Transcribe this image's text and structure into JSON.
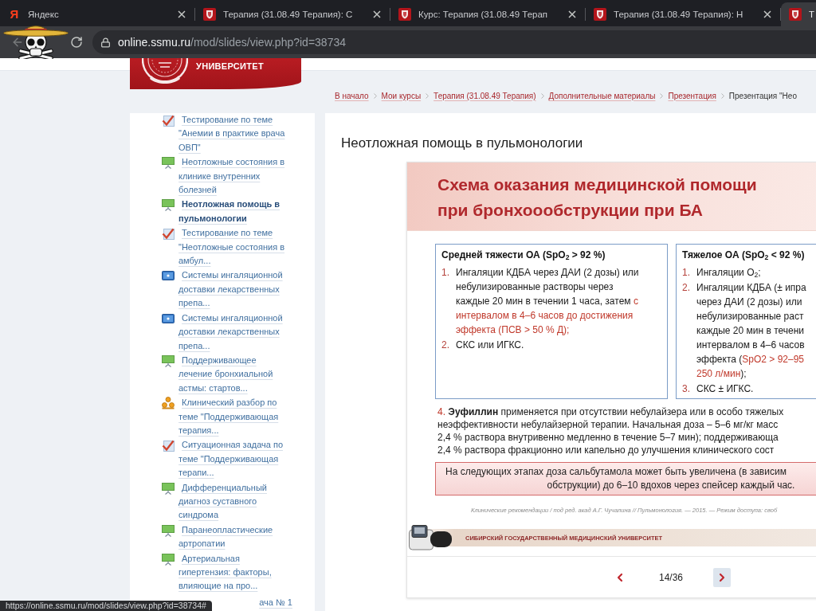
{
  "browser": {
    "tabs": [
      {
        "kind": "letter",
        "glyph": "Я",
        "title": "Яндекс",
        "closable": true,
        "selected": false
      },
      {
        "kind": "crest",
        "title": "Терапия (31.08.49 Терапия): С",
        "closable": true,
        "selected": false
      },
      {
        "kind": "crest",
        "title": "Курс: Терапия (31.08.49 Терап",
        "closable": true,
        "selected": false
      },
      {
        "kind": "crest",
        "title": "Терапия (31.08.49 Терапия): Н",
        "closable": true,
        "selected": false
      },
      {
        "kind": "crest",
        "title": "Т",
        "closable": false,
        "selected": true
      }
    ],
    "address_bar": {
      "host": "online.ssmu.ru",
      "path": "/mod/slides/view.php?id=38734"
    },
    "status_url": "https://online.ssmu.ru/mod/slides/view.php?id=38734#"
  },
  "header": {
    "logo_text": "УНИВЕРСИТЕТ"
  },
  "breadcrumb": [
    {
      "label": "В начало",
      "current": false
    },
    {
      "label": "Мои курсы",
      "current": false
    },
    {
      "label": "Терапия (31.08.49 Терапия)",
      "current": false
    },
    {
      "label": "Дополнительные материалы",
      "current": false
    },
    {
      "label": "Презентация",
      "current": false
    },
    {
      "label": "Презентация \"Нео",
      "current": true
    }
  ],
  "sidebar": {
    "items": [
      {
        "kind": "quiz",
        "label": "Тестирование по теме \"Анемии в практике врача ОВП\"",
        "selected": false
      },
      {
        "kind": "slides",
        "label": "Неотложные состояния в клинике внутренних болезней",
        "selected": false
      },
      {
        "kind": "slides",
        "label": "Неотложная помощь в пульмонологии",
        "selected": true
      },
      {
        "kind": "quiz",
        "label": "Тестирование по теме \"Неотложные состояния в амбул...",
        "selected": false
      },
      {
        "kind": "video",
        "label": "Системы ингаляционной доставки лекарственных препа...",
        "selected": false
      },
      {
        "kind": "video",
        "label": "Системы ингаляционной доставки лекарственных препа...",
        "selected": false
      },
      {
        "kind": "slides",
        "label": "Поддерживающее лечение бронхиальной астмы: стартов...",
        "selected": false
      },
      {
        "kind": "workshop",
        "label": "Клинический разбор по теме \"Поддерживающая терапия...",
        "selected": false
      },
      {
        "kind": "quiz",
        "label": "Ситуационная задача по теме \"Поддерживающая терапи...",
        "selected": false
      },
      {
        "kind": "slides",
        "label": "Дифференциальный диагноз суставного синдрома",
        "selected": false
      },
      {
        "kind": "slides",
        "label": "Паранеопластические артропатии",
        "selected": false
      },
      {
        "kind": "slides",
        "label": "Артериальная гипертензия: факторы, влияющие на про...",
        "selected": false
      }
    ],
    "cut_item": "ача № 1"
  },
  "content": {
    "title": "Неотложная помощь в пульмонологии",
    "slide": {
      "title_lines": [
        "Схема оказания медицинской помощи",
        "при бронхоообструкции при БА"
      ],
      "boxes": [
        {
          "heading": "Средней тяжести ОА (SpO$_{2}$ > 92 %)",
          "items": [
            {
              "number": "1.",
              "lines": [
                [
                  {
                    "text": "Ингаляции КДБА через ДАИ (2 дозы) или",
                    "highlight": false
                  }
                ],
                [
                  {
                    "text": "небулизированные растворы через",
                    "highlight": false
                  }
                ],
                [
                  {
                    "text": "каждые 20 мин в течении 1 часа, затем ",
                    "highlight": false
                  },
                  {
                    "text": "с",
                    "highlight": true
                  }
                ],
                [
                  {
                    "text": "интервалом в 4–6 часов до достижения",
                    "highlight": true
                  }
                ],
                [
                  {
                    "text": "эффекта (ПСВ > 50 % Д);",
                    "highlight": true
                  }
                ]
              ]
            },
            {
              "number": "2.",
              "lines": [
                [
                  {
                    "text": "СКС или ИГКС.",
                    "highlight": false
                  }
                ]
              ]
            }
          ]
        },
        {
          "heading": "Тяжелое ОА (SpO$_{2}$ < 92 %)",
          "items": [
            {
              "number": "1.",
              "lines": [
                [
                  {
                    "text": "Ингаляции O$_{2}$;",
                    "highlight": false
                  }
                ]
              ]
            },
            {
              "number": "2.",
              "lines": [
                [
                  {
                    "text": "Ингаляции КДБА (± ипра",
                    "highlight": false
                  }
                ],
                [
                  {
                    "text": "через ДАИ (2 дозы) или",
                    "highlight": false
                  }
                ],
                [
                  {
                    "text": "небулизированные раст",
                    "highlight": false
                  }
                ],
                [
                  {
                    "text": "каждые 20 мин в течени",
                    "highlight": false
                  }
                ],
                [
                  {
                    "text": "интервалом в 4–6 часов",
                    "highlight": false
                  }
                ],
                [
                  {
                    "text": "эффекта (",
                    "highlight": false
                  },
                  {
                    "text": "SpO2 > 92–95",
                    "highlight": true
                  }
                ],
                [
                  {
                    "text": "250 л/мин",
                    "highlight": true
                  },
                  {
                    "text": ");",
                    "highlight": false
                  }
                ]
              ]
            },
            {
              "number": "3.",
              "lines": [
                [
                  {
                    "text": "СКС ± ИГКС.",
                    "highlight": false
                  }
                ]
              ]
            }
          ]
        }
      ],
      "note": {
        "lines": [
          [
            {
              "text": "4.",
              "highlight": true
            },
            {
              "text": " **Эуфиллин** применяется при отсутствии небулайзера или в особо тяжелых",
              "highlight": false
            }
          ],
          [
            {
              "text": "неэффективности небулайзерной терапии. Начальная доза – 5–6 мг/кг масс",
              "highlight": false
            }
          ],
          [
            {
              "text": "2,4 % раствора внутривенно медленно в течение 5–7 мин); поддерживающа",
              "highlight": false
            }
          ],
          [
            {
              "text": "2,4 % раствора фракционно или капельно до улучшения клинического сост",
              "highlight": false
            }
          ]
        ]
      },
      "callout": {
        "lines": [
          "На следующих этапах доза сальбутамола может быть увеличена (в зависим",
          "обструкции) до 6–10 вдохов через спейсер каждый час."
        ]
      },
      "citation": "Клинические рекомендации / под ред. акад А.Г. Чучалина // Пульмонология. — 2015. — Режим доступа: своб",
      "footer_text": "СИБИРСКИЙ ГОСУДАРСТВЕННЫЙ МЕДИЦИНСКИЙ УНИВЕРСИТЕТ"
    },
    "pager": {
      "prev": {
        "hovered": false
      },
      "page": "14/36",
      "next": {
        "hovered": true
      }
    }
  }
}
